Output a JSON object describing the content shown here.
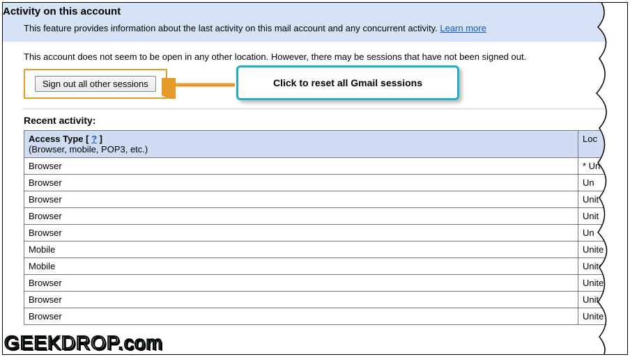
{
  "header": {
    "title": "Activity on this account",
    "description": "This feature provides information about the last activity on this mail account and any concurrent activity.",
    "learn_more": "Learn more"
  },
  "status": {
    "text": "This account does not seem to be open in any other location. However, there may be sessions that have not been signed out."
  },
  "signout": {
    "label": "Sign out all other sessions"
  },
  "recent": {
    "label": "Recent activity:"
  },
  "table": {
    "col1_title": "Access Type",
    "col1_help": "?",
    "col1_sub": "(Browser, mobile, POP3, etc.)",
    "col2_title": "Loc",
    "rows": [
      {
        "type": "Browser",
        "loc": "* Un"
      },
      {
        "type": "Browser",
        "loc": "Un"
      },
      {
        "type": "Browser",
        "loc": "Unit"
      },
      {
        "type": "Browser",
        "loc": "Unit"
      },
      {
        "type": "Browser",
        "loc": "Un"
      },
      {
        "type": "Mobile",
        "loc": "Unite"
      },
      {
        "type": "Mobile",
        "loc": "Unite"
      },
      {
        "type": "Browser",
        "loc": "Unite"
      },
      {
        "type": "Browser",
        "loc": "Unite"
      },
      {
        "type": "Browser",
        "loc": "Unite"
      }
    ]
  },
  "callout": {
    "text": "Click to reset all Gmail sessions"
  },
  "watermark": {
    "part1": "GEEK",
    "part2": "DROP",
    "part3": ".com"
  }
}
